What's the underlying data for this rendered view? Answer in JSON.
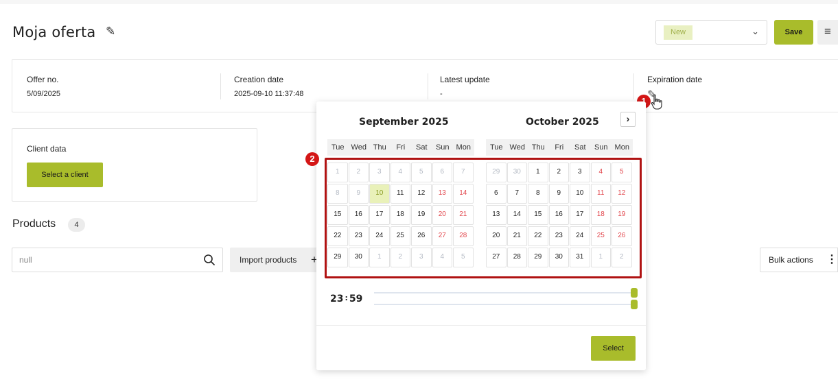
{
  "header": {
    "title": "Moja oferta",
    "status": "New",
    "save_label": "Save",
    "menu_icon": "hamburger-icon"
  },
  "info": {
    "offer_no_label": "Offer no.",
    "offer_no_value": "5/09/2025",
    "creation_label": "Creation date",
    "creation_value": "2025-09-10 11:37:48",
    "update_label": "Latest update",
    "update_value": "-",
    "expiration_label": "Expiration date"
  },
  "client": {
    "title": "Client data",
    "select_label": "Select a client"
  },
  "products": {
    "title": "Products",
    "count": "4",
    "search_placeholder": "null",
    "import_label": "Import products",
    "bulk_label": "Bulk actions"
  },
  "annotations": {
    "badge1": "1",
    "badge2": "2"
  },
  "datepicker": {
    "months": [
      {
        "title": "September  2025",
        "weekdays": [
          "Tue",
          "Wed",
          "Thu",
          "Fri",
          "Sat",
          "Sun",
          "Mon"
        ],
        "days": [
          {
            "d": "1",
            "t": "muted"
          },
          {
            "d": "2",
            "t": "muted"
          },
          {
            "d": "3",
            "t": "muted"
          },
          {
            "d": "4",
            "t": "muted"
          },
          {
            "d": "5",
            "t": "muted"
          },
          {
            "d": "6",
            "t": "muted"
          },
          {
            "d": "7",
            "t": "muted"
          },
          {
            "d": "8",
            "t": "muted"
          },
          {
            "d": "9",
            "t": "muted"
          },
          {
            "d": "10",
            "t": "today"
          },
          {
            "d": "11",
            "t": ""
          },
          {
            "d": "12",
            "t": ""
          },
          {
            "d": "13",
            "t": "weekend"
          },
          {
            "d": "14",
            "t": "weekend"
          },
          {
            "d": "15",
            "t": ""
          },
          {
            "d": "16",
            "t": ""
          },
          {
            "d": "17",
            "t": ""
          },
          {
            "d": "18",
            "t": ""
          },
          {
            "d": "19",
            "t": ""
          },
          {
            "d": "20",
            "t": "weekend"
          },
          {
            "d": "21",
            "t": "weekend"
          },
          {
            "d": "22",
            "t": ""
          },
          {
            "d": "23",
            "t": ""
          },
          {
            "d": "24",
            "t": ""
          },
          {
            "d": "25",
            "t": ""
          },
          {
            "d": "26",
            "t": ""
          },
          {
            "d": "27",
            "t": "weekend"
          },
          {
            "d": "28",
            "t": "weekend"
          },
          {
            "d": "29",
            "t": ""
          },
          {
            "d": "30",
            "t": ""
          },
          {
            "d": "1",
            "t": "muted"
          },
          {
            "d": "2",
            "t": "muted"
          },
          {
            "d": "3",
            "t": "muted"
          },
          {
            "d": "4",
            "t": "muted"
          },
          {
            "d": "5",
            "t": "muted"
          }
        ]
      },
      {
        "title": "October  2025",
        "weekdays": [
          "Tue",
          "Wed",
          "Thu",
          "Fri",
          "Sat",
          "Sun",
          "Mon"
        ],
        "days": [
          {
            "d": "29",
            "t": "muted"
          },
          {
            "d": "30",
            "t": "muted"
          },
          {
            "d": "1",
            "t": ""
          },
          {
            "d": "2",
            "t": ""
          },
          {
            "d": "3",
            "t": ""
          },
          {
            "d": "4",
            "t": "weekend"
          },
          {
            "d": "5",
            "t": "weekend"
          },
          {
            "d": "6",
            "t": ""
          },
          {
            "d": "7",
            "t": ""
          },
          {
            "d": "8",
            "t": ""
          },
          {
            "d": "9",
            "t": ""
          },
          {
            "d": "10",
            "t": ""
          },
          {
            "d": "11",
            "t": "weekend"
          },
          {
            "d": "12",
            "t": "weekend"
          },
          {
            "d": "13",
            "t": ""
          },
          {
            "d": "14",
            "t": ""
          },
          {
            "d": "15",
            "t": ""
          },
          {
            "d": "16",
            "t": ""
          },
          {
            "d": "17",
            "t": ""
          },
          {
            "d": "18",
            "t": "weekend"
          },
          {
            "d": "19",
            "t": "weekend"
          },
          {
            "d": "20",
            "t": ""
          },
          {
            "d": "21",
            "t": ""
          },
          {
            "d": "22",
            "t": ""
          },
          {
            "d": "23",
            "t": ""
          },
          {
            "d": "24",
            "t": ""
          },
          {
            "d": "25",
            "t": "weekend"
          },
          {
            "d": "26",
            "t": "weekend"
          },
          {
            "d": "27",
            "t": ""
          },
          {
            "d": "28",
            "t": ""
          },
          {
            "d": "29",
            "t": ""
          },
          {
            "d": "30",
            "t": ""
          },
          {
            "d": "31",
            "t": ""
          },
          {
            "d": "1",
            "t": "muted"
          },
          {
            "d": "2",
            "t": "muted"
          }
        ]
      }
    ],
    "next_icon": "chevron-right-icon",
    "hour": "23",
    "minute": "59",
    "select_label": "Select"
  },
  "colors": {
    "accent": "#a9bc2b",
    "weekend": "#e2484e",
    "highlight": "#b01212"
  }
}
